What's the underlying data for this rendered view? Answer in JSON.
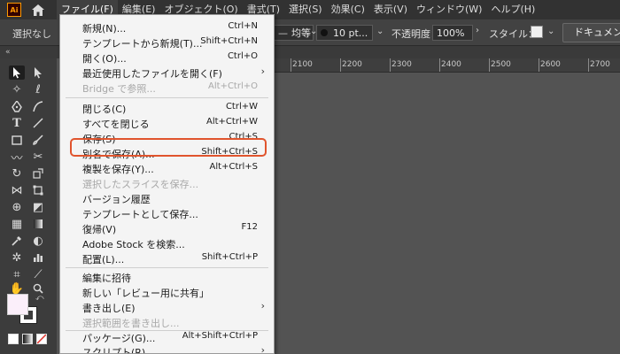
{
  "menubar": {
    "logo_text": "Ai",
    "items": [
      {
        "label": "ファイル(F)",
        "active": true
      },
      {
        "label": "編集(E)"
      },
      {
        "label": "オブジェクト(O)"
      },
      {
        "label": "書式(T)"
      },
      {
        "label": "選択(S)"
      },
      {
        "label": "効果(C)"
      },
      {
        "label": "表示(V)"
      },
      {
        "label": "ウィンドウ(W)"
      },
      {
        "label": "ヘルプ(H)"
      }
    ]
  },
  "controlbar": {
    "selection_label": "選択なし",
    "stroke_profile": "均等",
    "brush_size": "10 pt...",
    "opacity_label": "不透明度：",
    "opacity_value": "100%",
    "style_label": "スタイル：",
    "document_setup": "ドキュメント設定"
  },
  "ruler": {
    "ticks": [
      "2100",
      "2200",
      "2300",
      "2400",
      "2500",
      "2600",
      "2700"
    ]
  },
  "file_menu": {
    "items": [
      {
        "label": "新規(N)...",
        "shortcut": "Ctrl+N"
      },
      {
        "label": "テンプレートから新規(T)...",
        "shortcut": "Shift+Ctrl+N"
      },
      {
        "label": "開く(O)...",
        "shortcut": "Ctrl+O"
      },
      {
        "label": "最近使用したファイルを開く(F)",
        "shortcut": "",
        "submenu": true
      },
      {
        "label": "Bridge で参照...",
        "shortcut": "Alt+Ctrl+O",
        "disabled": true
      },
      {
        "label": "閉じる(C)",
        "shortcut": "Ctrl+W"
      },
      {
        "label": "すべてを閉じる",
        "shortcut": "Alt+Ctrl+W"
      },
      {
        "label": "保存(S)",
        "shortcut": "Ctrl+S"
      },
      {
        "label": "別名で保存(A)...",
        "shortcut": "Shift+Ctrl+S",
        "highlighted": true
      },
      {
        "label": "複製を保存(Y)...",
        "shortcut": "Alt+Ctrl+S"
      },
      {
        "label": "選択したスライスを保存...",
        "shortcut": "",
        "disabled": true
      },
      {
        "label": "バージョン履歴",
        "shortcut": ""
      },
      {
        "label": "テンプレートとして保存...",
        "shortcut": ""
      },
      {
        "label": "復帰(V)",
        "shortcut": "F12"
      },
      {
        "label": "Adobe Stock を検索...",
        "shortcut": ""
      },
      {
        "label": "配置(L)...",
        "shortcut": "Shift+Ctrl+P"
      },
      {
        "label": "編集に招待",
        "shortcut": ""
      },
      {
        "label": "新しい「レビュー用に共有」",
        "shortcut": ""
      },
      {
        "label": "書き出し(E)",
        "shortcut": "",
        "submenu": true
      },
      {
        "label": "選択範囲を書き出し...",
        "shortcut": "",
        "disabled": true
      },
      {
        "label": "パッケージ(G)...",
        "shortcut": "Alt+Shift+Ctrl+P"
      },
      {
        "label": "スクリプト(R)",
        "shortcut": "",
        "submenu": true
      }
    ],
    "highlight_color": "#e0542d"
  },
  "colors": {
    "menubar_bg": "#323232",
    "workspace_bg": "#535353",
    "menu_bg": "#f4f4f4",
    "brand": "#ff9a00"
  }
}
